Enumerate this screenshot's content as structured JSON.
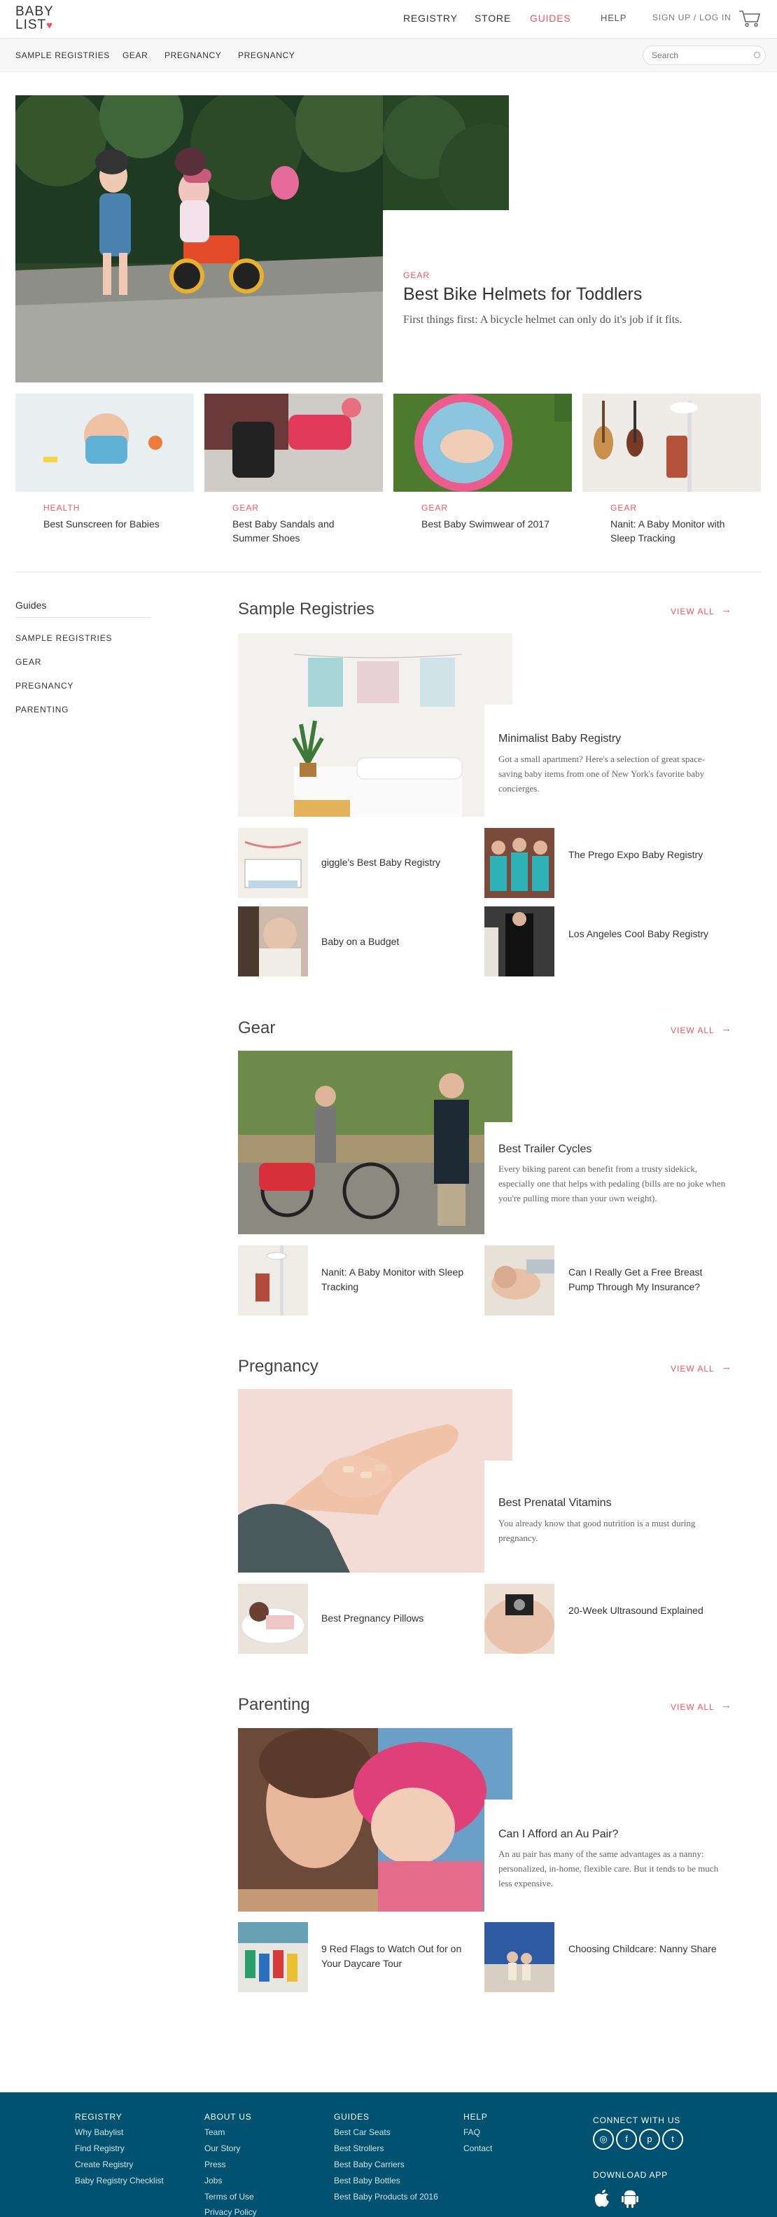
{
  "header": {
    "logo_line1": "BABY",
    "logo_line2": "LIST",
    "logo_heart": "♥",
    "nav": [
      "REGISTRY",
      "STORE",
      "GUIDES",
      "HELP",
      "SIGN UP / LOG IN"
    ],
    "cart_icon": "cart-icon"
  },
  "subnav": {
    "items": [
      "SAMPLE REGISTRIES",
      "GEAR",
      "PREGNANCY",
      "PREGNANCY"
    ],
    "search_placeholder": "Search"
  },
  "hero": {
    "category": "GEAR",
    "title": "Best Bike Helmets for Toddlers",
    "subtitle": "First things first: A bicycle helmet can only do it's job if it fits."
  },
  "cards": [
    {
      "category": "HEALTH",
      "title": "Best Sunscreen for Babies"
    },
    {
      "category": "GEAR",
      "title": "Best Baby Sandals and Summer Shoes"
    },
    {
      "category": "GEAR",
      "title": "Best Baby Swimwear of 2017"
    },
    {
      "category": "GEAR",
      "title": "Nanit: A Baby Monitor with Sleep Tracking"
    }
  ],
  "sidebar": {
    "heading": "Guides",
    "items": [
      "SAMPLE REGISTRIES",
      "GEAR",
      "PREGNANCY",
      "PARENTING"
    ]
  },
  "view_all": "VIEW ALL",
  "sections": [
    {
      "title": "Sample Registries",
      "featured": {
        "title": "Minimalist Baby Registry",
        "desc": "Got a small apartment? Here's a selection of great space-saving baby items from one of New York's favorite baby concierges."
      },
      "items": [
        "giggle's Best Baby Registry",
        "The Prego Expo Baby Registry",
        "Baby on a Budget",
        "Los Angeles Cool Baby Registry"
      ]
    },
    {
      "title": "Gear",
      "featured": {
        "title": "Best Trailer Cycles",
        "desc": "Every biking parent can benefit from a trusty sidekick, especially one that helps with pedaling (bills are no joke when you're pulling more than your own weight)."
      },
      "items": [
        "Nanit: A Baby Monitor with Sleep Tracking",
        "Can I Really Get a Free Breast Pump Through My Insurance?"
      ]
    },
    {
      "title": "Pregnancy",
      "featured": {
        "title": "Best Prenatal Vitamins",
        "desc": "You already know that good nutrition is a must during pregnancy."
      },
      "items": [
        "Best Pregnancy Pillows",
        "20-Week Ultrasound Explained"
      ]
    },
    {
      "title": "Parenting",
      "featured": {
        "title": "Can I Afford an Au Pair?",
        "desc": "An au pair has many of the same advantages as a nanny: personalized, in-home, flexible care. But it tends to be much less expensive."
      },
      "items": [
        "9 Red Flags to Watch Out for on Your Daycare Tour",
        "Choosing Childcare: Nanny Share"
      ]
    }
  ],
  "footer": {
    "registry": {
      "heading": "REGISTRY",
      "links": [
        "Why Babylist",
        "Find Registry",
        "Create Registry",
        "Baby Registry Checklist"
      ]
    },
    "about": {
      "heading": "ABOUT US",
      "links": [
        "Team",
        "Our Story",
        "Press",
        "Jobs",
        "Terms of Use",
        "Privacy Policy"
      ]
    },
    "guides": {
      "heading": "GUIDES",
      "links": [
        "Best Car Seats",
        "Best Strollers",
        "Best Baby Carriers",
        "Best Baby Bottles",
        "Best Baby Products of 2016"
      ]
    },
    "help": {
      "heading": "HELP",
      "links": [
        "FAQ",
        "Contact"
      ]
    },
    "connect": {
      "heading": "CONNECT WITH US",
      "icons": [
        "instagram-icon",
        "facebook-icon",
        "pinterest-icon",
        "twitter-icon"
      ]
    },
    "app": {
      "heading": "DOWNLOAD APP",
      "icons": [
        "apple-icon",
        "android-icon"
      ]
    }
  },
  "colors": {
    "accent": "#f0545d",
    "footer": "#005270",
    "text": "#333333"
  }
}
